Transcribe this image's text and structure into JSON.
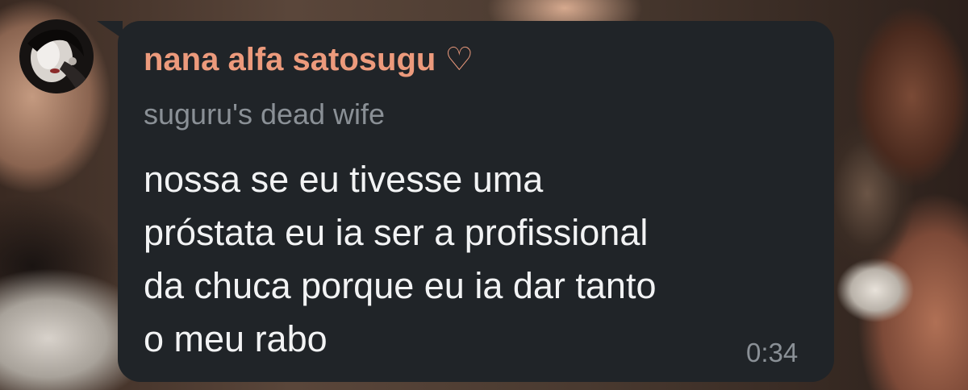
{
  "message": {
    "sender_name": "nana alfa satosugu ♡",
    "sender_title": "suguru's dead wife",
    "text": "nossa se eu tivesse uma\npróstata eu ia ser a profissional\nda chuca porque eu ia dar tanto\no meu rabo",
    "time": "0:34"
  },
  "colors": {
    "sender_name": "#ec9a7c",
    "bubble_bg": "#202428",
    "secondary_text": "#8a9096",
    "message_text": "#f2f3f4"
  },
  "icons": {
    "avatar": "sender-avatar-photo"
  }
}
